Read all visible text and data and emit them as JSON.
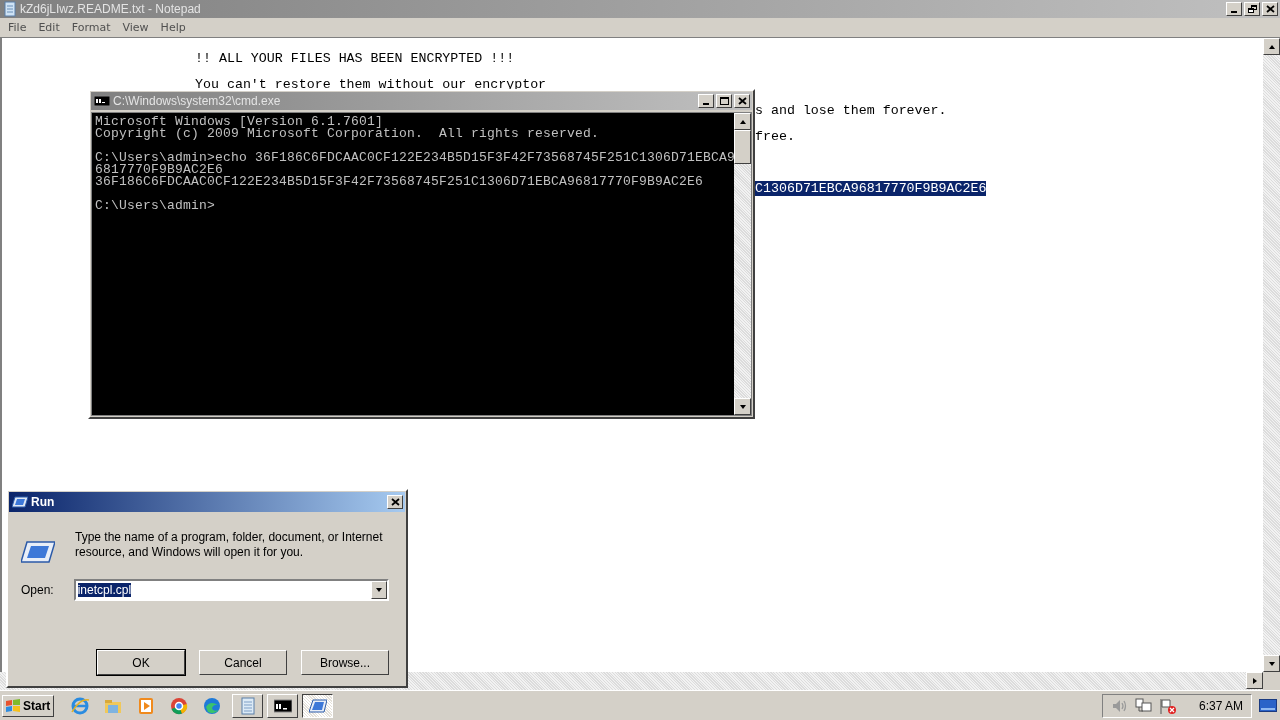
{
  "notepad": {
    "title": "kZd6jLIwz.README.txt - Notepad",
    "active": false,
    "menu": [
      "File",
      "Edit",
      "Format",
      "View",
      "Help"
    ],
    "lines": [
      {
        "text": "!! ALL YOUR FILES HAS BEEN ENCRYPTED !!!",
        "kind": "line",
        "selected": false
      },
      {
        "text": "You can't restore them without our encryptor",
        "kind": "line",
        "selected": false
      },
      {
        "text": "s and lose them forever.",
        "kind": "tail",
        "selected": false
      },
      {
        "text": "free.",
        "kind": "tail",
        "selected": false
      },
      {
        "text": "C1306D71EBCA96817770F9B9AC2E6",
        "kind": "tail_gap",
        "selected": true
      }
    ]
  },
  "console": {
    "title": "C:\\Windows\\system32\\cmd.exe",
    "active": false,
    "blocks": [
      [
        "Microsoft Windows [Version 6.1.7601]",
        "Copyright (c) 2009 Microsoft Corporation.  All rights reserved."
      ],
      [
        "C:\\Users\\admin>echo 36F186C6FDCAAC0CF122E234B5D15F3F42F73568745F251C1306D71EBCA9",
        "6817770F9B9AC2E6",
        "36F186C6FDCAAC0CF122E234B5D15F3F42F73568745F251C1306D71EBCA96817770F9B9AC2E6"
      ],
      [
        "C:\\Users\\admin>"
      ]
    ]
  },
  "run": {
    "title": "Run",
    "active": true,
    "description": "Type the name of a program, folder, document, or Internet resource, and Windows will open it for you.",
    "open_label": "Open:",
    "value": "inetcpl.cpl",
    "value_selected": true,
    "buttons": [
      {
        "label": "OK",
        "default": true
      },
      {
        "label": "Cancel",
        "default": false
      },
      {
        "label": "Browse...",
        "default": false
      }
    ]
  },
  "taskbar": {
    "start": "Start",
    "tasks": [
      {
        "kind": "notepad",
        "selected": false
      },
      {
        "kind": "console",
        "selected": false
      },
      {
        "kind": "run",
        "selected": true
      }
    ],
    "clock": "6:37 AM"
  }
}
